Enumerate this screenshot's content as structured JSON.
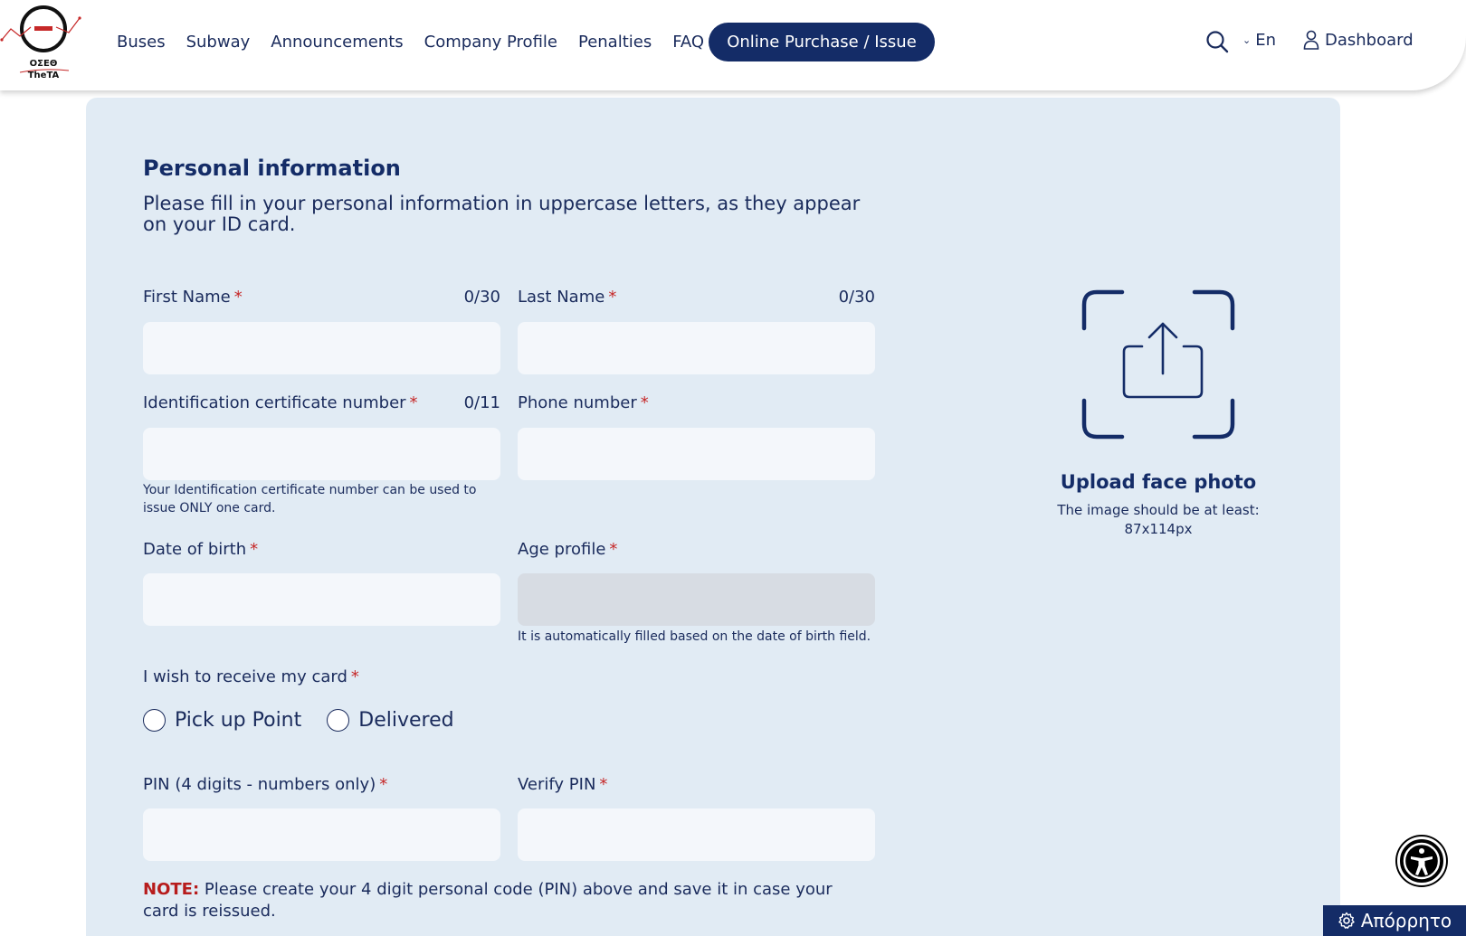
{
  "header": {
    "logo": {
      "line1": "ΟΣΕΘ",
      "line2": "TheTA"
    },
    "nav": [
      {
        "label": "Buses"
      },
      {
        "label": "Subway"
      },
      {
        "label": "Announcements"
      },
      {
        "label": "Company Profile"
      },
      {
        "label": "Penalties"
      },
      {
        "label": "FAQ"
      }
    ],
    "cta_label": "Online Purchase / Issue",
    "language": "En",
    "dashboard_label": "Dashboard"
  },
  "form": {
    "title": "Personal information",
    "subtitle": "Please fill in your personal information in uppercase letters, as they appear on your ID card.",
    "required_mark": "*",
    "first_name": {
      "label": "First Name",
      "counter": "0/30",
      "value": ""
    },
    "last_name": {
      "label": "Last Name",
      "counter": "0/30",
      "value": ""
    },
    "id_number": {
      "label": "Identification certificate number",
      "counter": "0/11",
      "value": "",
      "hint": "Your Identification certificate number can be used to issue ONLY one card."
    },
    "phone": {
      "label": "Phone number",
      "value": ""
    },
    "dob": {
      "label": "Date of birth",
      "value": ""
    },
    "age_profile": {
      "label": "Age profile",
      "value": "",
      "hint": "It is automatically filled based on the date of birth field."
    },
    "receive": {
      "label": "I wish to receive my card",
      "options": [
        "Pick up Point",
        "Delivered"
      ]
    },
    "pin": {
      "label": "PIN (4 digits - numbers only)",
      "value": ""
    },
    "verify_pin": {
      "label": "Verify PIN",
      "value": ""
    },
    "note_prefix": "NOTE:",
    "note_text": " Please create your 4 digit personal code (PIN) above and save it in case your card is reissued."
  },
  "upload": {
    "title": "Upload face photo",
    "hint": "The image should be at least: 87x114px"
  },
  "footer": {
    "privacy_label": "Απόρρητο"
  },
  "colors": {
    "brand_navy": "#142c67",
    "panel_bg": "#e1ebf4",
    "required_red": "#c62828"
  }
}
